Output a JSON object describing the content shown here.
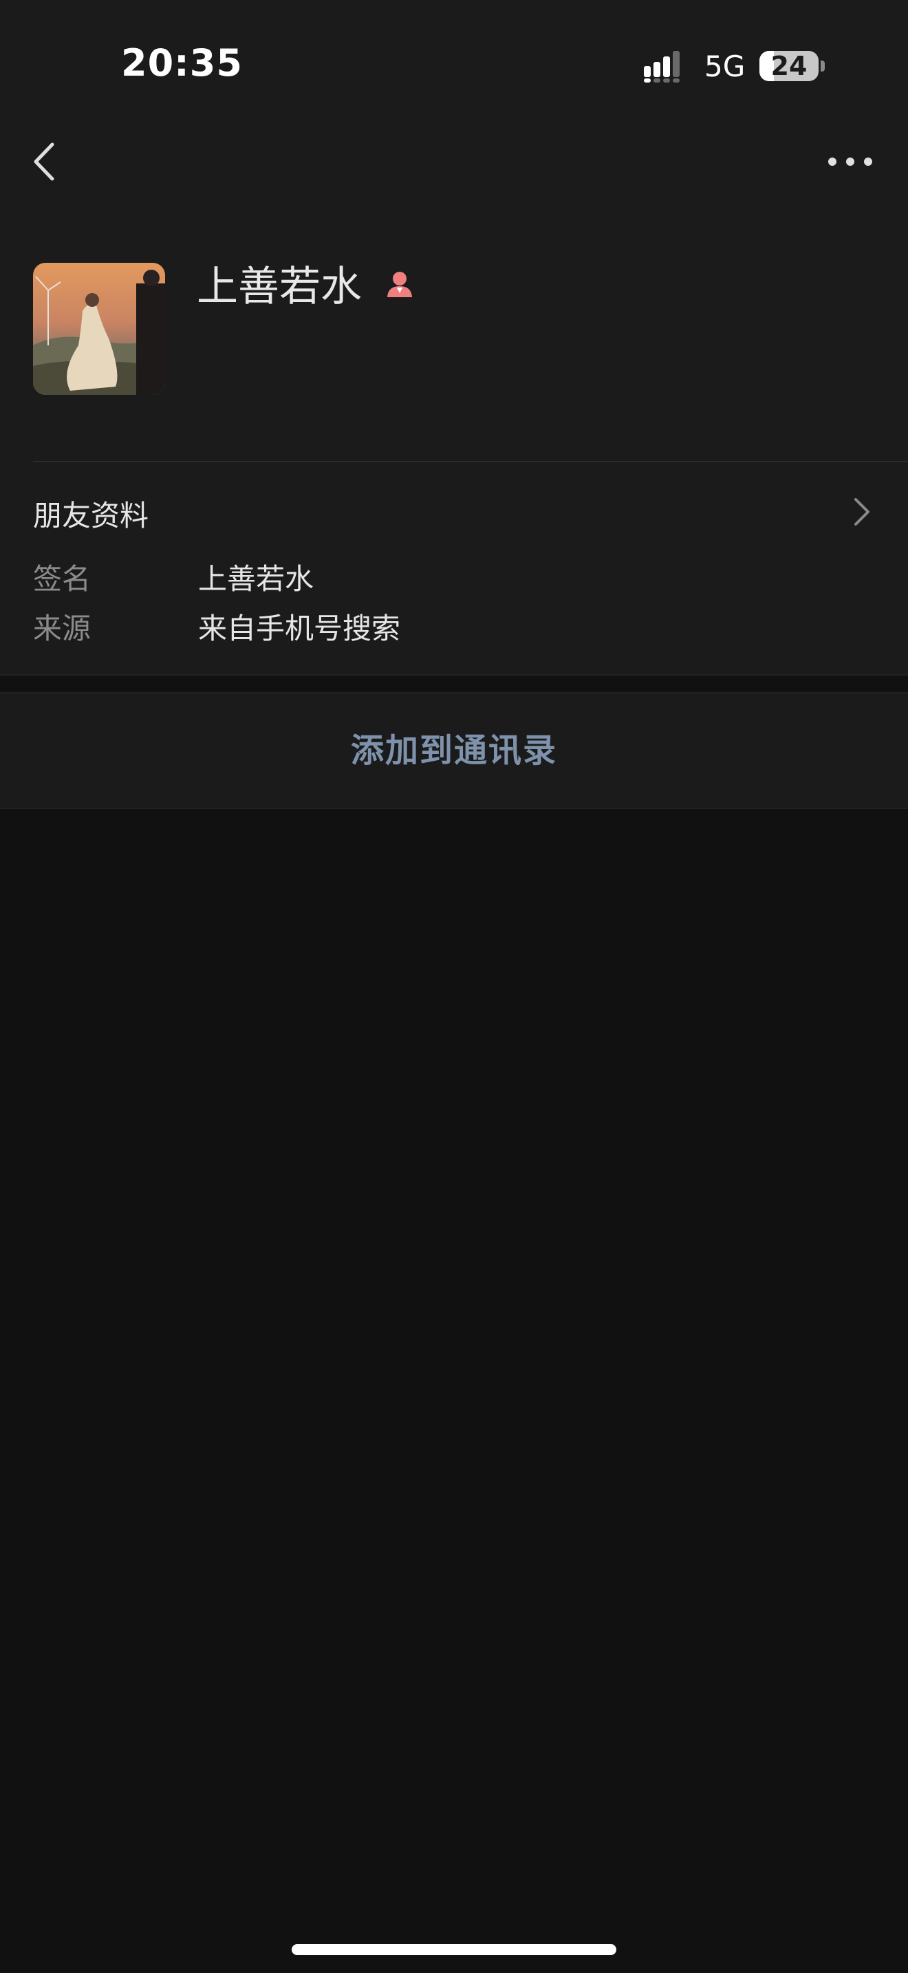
{
  "status_bar": {
    "time": "20:35",
    "network": "5G",
    "battery_level": "24",
    "battery_fraction": 0.24,
    "signal_bars_active": 3,
    "signal_bars_total": 4
  },
  "nav": {
    "back_icon": "chevron-left-icon",
    "more_icon": "more-horizontal-icon"
  },
  "profile": {
    "name": "上善若水",
    "gender_icon": "female-person-icon",
    "gender_color": "#f08080",
    "avatar": "wedding-photo-avatar"
  },
  "friend_info": {
    "title": "朋友资料",
    "rows": [
      {
        "label": "签名",
        "value": "上善若水"
      },
      {
        "label": "来源",
        "value": "来自手机号搜索"
      }
    ]
  },
  "actions": {
    "add_to_contacts": "添加到通讯录"
  },
  "colors": {
    "background": "#111111",
    "panel": "#1b1b1c",
    "accent_link": "#7f92ab"
  }
}
